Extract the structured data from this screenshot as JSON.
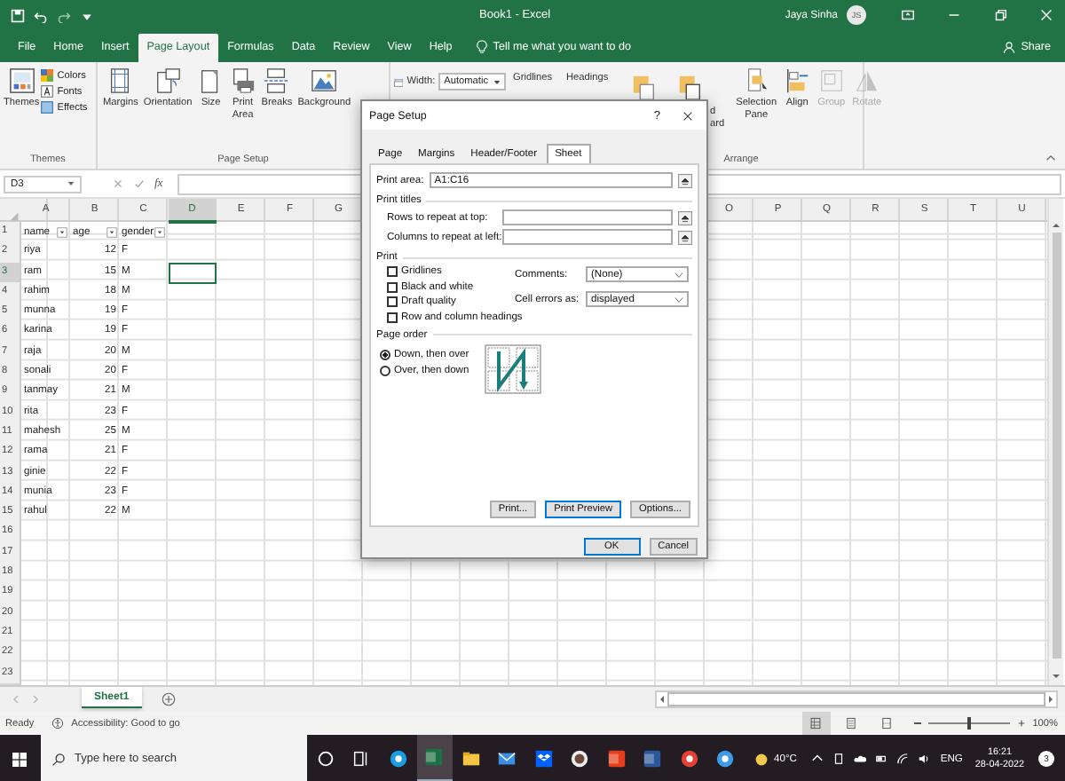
{
  "title_bar": {
    "title": "Book1 - Excel",
    "user": "Jaya Sinha",
    "avatar_initials": "JS"
  },
  "ribbon_tabs": [
    {
      "label": "File",
      "selected": false
    },
    {
      "label": "Home",
      "selected": false
    },
    {
      "label": "Insert",
      "selected": false
    },
    {
      "label": "Page Layout",
      "selected": true
    },
    {
      "label": "Formulas",
      "selected": false
    },
    {
      "label": "Data",
      "selected": false
    },
    {
      "label": "Review",
      "selected": false
    },
    {
      "label": "View",
      "selected": false
    },
    {
      "label": "Help",
      "selected": false
    }
  ],
  "tell_me": {
    "placeholder": "Tell me what you want to do"
  },
  "share": "Share",
  "ribbon": {
    "themes_group": {
      "name": "Themes",
      "big": "Themes",
      "small": [
        "Colors",
        "Fonts",
        "Effects"
      ]
    },
    "page_setup_group": {
      "name": "Page Setup",
      "buttons": [
        "Margins",
        "Orientation",
        "Size",
        "Print Area",
        "Breaks",
        "Background"
      ]
    },
    "scale": {
      "width_label": "Width:",
      "width_value": "Automatic"
    },
    "sheet_options": [
      "Gridlines",
      "Headings"
    ],
    "arrange_group": {
      "name": "Arrange",
      "cut_labels": [
        "d",
        "ard"
      ],
      "buttons": [
        {
          "label": "Selection Pane",
          "disabled": false
        },
        {
          "label": "Align",
          "disabled": false
        },
        {
          "label": "Group",
          "disabled": true
        },
        {
          "label": "Rotate",
          "disabled": true
        }
      ]
    }
  },
  "formula_bar": {
    "name_box": "D3",
    "fx": "fx"
  },
  "sheet": {
    "columns_left": [
      {
        "label": "A",
        "selected": false
      },
      {
        "label": "B",
        "selected": false
      },
      {
        "label": "C",
        "selected": false
      },
      {
        "label": "D",
        "selected": true
      },
      {
        "label": "E",
        "selected": false
      },
      {
        "label": "F",
        "selected": false
      },
      {
        "label": "G",
        "selected": false
      }
    ],
    "columns_right": [
      "O",
      "P",
      "Q",
      "R",
      "S",
      "T",
      "U"
    ],
    "rows": [
      {
        "number": "1",
        "kind": "header",
        "selected": false,
        "cells": [
          "name",
          "age",
          "gender"
        ]
      },
      {
        "number": "2",
        "kind": "data",
        "selected": false,
        "cells": [
          "riya",
          "12",
          "F"
        ]
      },
      {
        "number": "3",
        "kind": "data",
        "selected": true,
        "cells": [
          "ram",
          "15",
          "M"
        ]
      },
      {
        "number": "4",
        "kind": "data",
        "selected": false,
        "cells": [
          "rahim",
          "18",
          "M"
        ]
      },
      {
        "number": "5",
        "kind": "data",
        "selected": false,
        "cells": [
          "munna",
          "19",
          "F"
        ]
      },
      {
        "number": "6",
        "kind": "data",
        "selected": false,
        "cells": [
          "karina",
          "19",
          "F"
        ]
      },
      {
        "number": "7",
        "kind": "data",
        "selected": false,
        "cells": [
          "raja",
          "20",
          "M"
        ]
      },
      {
        "number": "8",
        "kind": "data",
        "selected": false,
        "cells": [
          "sonali",
          "20",
          "F"
        ]
      },
      {
        "number": "9",
        "kind": "data",
        "selected": false,
        "cells": [
          "tanmay",
          "21",
          "M"
        ]
      },
      {
        "number": "10",
        "kind": "data",
        "selected": false,
        "cells": [
          "rita",
          "23",
          "F"
        ]
      },
      {
        "number": "11",
        "kind": "data",
        "selected": false,
        "cells": [
          "mahesh",
          "25",
          "M"
        ]
      },
      {
        "number": "12",
        "kind": "data",
        "selected": false,
        "cells": [
          "rama",
          "21",
          "F"
        ]
      },
      {
        "number": "13",
        "kind": "data",
        "selected": false,
        "cells": [
          "ginie",
          "22",
          "F"
        ]
      },
      {
        "number": "14",
        "kind": "data",
        "selected": false,
        "cells": [
          "munia",
          "23",
          "F"
        ]
      },
      {
        "number": "15",
        "kind": "data",
        "selected": false,
        "cells": [
          "rahul",
          "22",
          "M"
        ]
      },
      {
        "number": "16",
        "kind": "empty",
        "selected": false
      },
      {
        "number": "17",
        "kind": "empty",
        "selected": false
      },
      {
        "number": "18",
        "kind": "empty",
        "selected": false
      },
      {
        "number": "19",
        "kind": "empty",
        "selected": false
      },
      {
        "number": "20",
        "kind": "empty",
        "selected": false
      },
      {
        "number": "21",
        "kind": "empty",
        "selected": false
      },
      {
        "number": "22",
        "kind": "empty",
        "selected": false
      },
      {
        "number": "23",
        "kind": "empty",
        "selected": false
      }
    ]
  },
  "sheet_tabs": [
    {
      "label": "Sheet1",
      "selected": true
    }
  ],
  "status_bar": {
    "ready": "Ready",
    "accessibility": "Accessibility: Good to go",
    "views": [
      {
        "kind": "normal",
        "selected": true
      },
      {
        "kind": "page-layout",
        "selected": false
      },
      {
        "kind": "page-break",
        "selected": false
      }
    ],
    "zoom": {
      "level": 0.5,
      "reading": "100%"
    }
  },
  "dialog": {
    "title": "Page Setup",
    "help": "?",
    "tabs": [
      {
        "label": "Page",
        "selected": false
      },
      {
        "label": "Margins",
        "selected": false
      },
      {
        "label": "Header/Footer",
        "selected": false
      },
      {
        "label": "Sheet",
        "selected": true
      }
    ],
    "print_area": {
      "label": "Print area:",
      "value": "A1:C16"
    },
    "print_titles": {
      "heading": "Print titles",
      "fields": [
        "Rows to repeat at top:",
        "Columns to repeat at left:"
      ]
    },
    "print": {
      "heading": "Print",
      "checkboxes": [
        {
          "label": "Gridlines",
          "checked": false
        },
        {
          "label": "Black and white",
          "checked": false
        },
        {
          "label": "Draft quality",
          "checked": false
        },
        {
          "label": "Row and column headings",
          "checked": false
        }
      ],
      "selects": [
        {
          "label": "Comments:",
          "value": "(None)"
        },
        {
          "label": "Cell errors as:",
          "value": "displayed"
        }
      ]
    },
    "page_order": {
      "heading": "Page order",
      "options": [
        {
          "label": "Down, then over",
          "selected": true
        },
        {
          "label": "Over, then down",
          "selected": false
        }
      ]
    },
    "buttons": [
      "Print...",
      "Print Preview",
      "Options..."
    ],
    "footer_buttons": [
      "OK",
      "Cancel"
    ]
  },
  "taskbar": {
    "search": {
      "placeholder": "Type here to search"
    },
    "apps": [
      {
        "kind": "cortana",
        "active": false
      },
      {
        "kind": "task-view",
        "active": false
      },
      {
        "kind": "edge",
        "active": false
      },
      {
        "kind": "excel",
        "active": true
      },
      {
        "kind": "explorer",
        "active": false
      },
      {
        "kind": "mail",
        "active": false
      },
      {
        "kind": "dropbox",
        "active": false
      },
      {
        "kind": "circle-app",
        "active": false
      },
      {
        "kind": "office",
        "active": false
      },
      {
        "kind": "word",
        "active": false
      },
      {
        "kind": "chrome",
        "active": false
      },
      {
        "kind": "help",
        "active": false
      }
    ],
    "weather": "40°C",
    "language": "ENG",
    "time": "16:21",
    "date": "28-04-2022",
    "notifications": "3"
  }
}
